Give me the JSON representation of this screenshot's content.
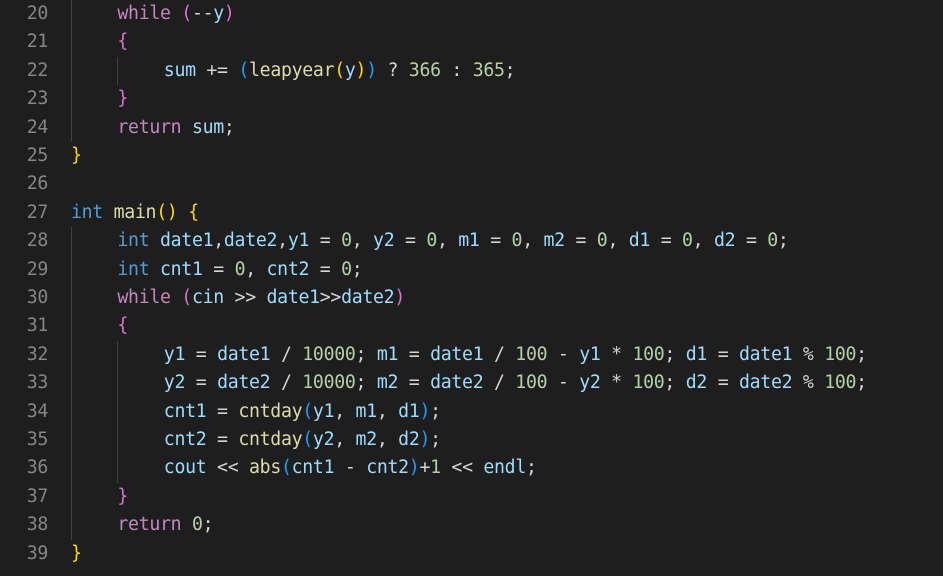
{
  "editor": {
    "language": "C++",
    "theme_colors": {
      "background": "#1e1e1e",
      "line_number": "#858585",
      "keyword": "#569cd6",
      "control": "#c586c0",
      "variable": "#9cdcfe",
      "function": "#dcdcaa",
      "number": "#b5cea8",
      "bracket_level_1": "#ffd700",
      "bracket_level_2": "#da70d6",
      "bracket_level_3": "#179fff"
    },
    "lines": [
      {
        "n": "20",
        "tokens": [
          [
            "ctl",
            "while"
          ],
          [
            "op",
            " "
          ],
          [
            "b2",
            "("
          ],
          [
            "op",
            "--"
          ],
          [
            "var",
            "y"
          ],
          [
            "b2",
            ")"
          ]
        ]
      },
      {
        "n": "21",
        "tokens": [
          [
            "b2",
            "{"
          ]
        ]
      },
      {
        "n": "22",
        "tokens": [
          [
            "var",
            "sum"
          ],
          [
            "op",
            " += "
          ],
          [
            "b3",
            "("
          ],
          [
            "fn",
            "leapyear"
          ],
          [
            "b1",
            "("
          ],
          [
            "var",
            "y"
          ],
          [
            "b1",
            ")"
          ],
          [
            "b3",
            ")"
          ],
          [
            "op",
            " ? "
          ],
          [
            "num",
            "366"
          ],
          [
            "op",
            " : "
          ],
          [
            "num",
            "365"
          ],
          [
            "op",
            ";"
          ]
        ]
      },
      {
        "n": "23",
        "tokens": [
          [
            "b2",
            "}"
          ]
        ]
      },
      {
        "n": "24",
        "tokens": [
          [
            "ctl",
            "return"
          ],
          [
            "op",
            " "
          ],
          [
            "var",
            "sum"
          ],
          [
            "op",
            ";"
          ]
        ]
      },
      {
        "n": "25",
        "tokens": [
          [
            "b1",
            "}"
          ]
        ]
      },
      {
        "n": "26",
        "tokens": []
      },
      {
        "n": "27",
        "tokens": [
          [
            "kw",
            "int"
          ],
          [
            "op",
            " "
          ],
          [
            "fn",
            "main"
          ],
          [
            "b1",
            "()"
          ],
          [
            "op",
            " "
          ],
          [
            "b1",
            "{"
          ]
        ]
      },
      {
        "n": "28",
        "tokens": [
          [
            "kw",
            "int"
          ],
          [
            "op",
            " "
          ],
          [
            "var",
            "date1"
          ],
          [
            "op",
            ","
          ],
          [
            "var",
            "date2"
          ],
          [
            "op",
            ","
          ],
          [
            "var",
            "y1"
          ],
          [
            "op",
            " = "
          ],
          [
            "num",
            "0"
          ],
          [
            "op",
            ", "
          ],
          [
            "var",
            "y2"
          ],
          [
            "op",
            " = "
          ],
          [
            "num",
            "0"
          ],
          [
            "op",
            ", "
          ],
          [
            "var",
            "m1"
          ],
          [
            "op",
            " = "
          ],
          [
            "num",
            "0"
          ],
          [
            "op",
            ", "
          ],
          [
            "var",
            "m2"
          ],
          [
            "op",
            " = "
          ],
          [
            "num",
            "0"
          ],
          [
            "op",
            ", "
          ],
          [
            "var",
            "d1"
          ],
          [
            "op",
            " = "
          ],
          [
            "num",
            "0"
          ],
          [
            "op",
            ", "
          ],
          [
            "var",
            "d2"
          ],
          [
            "op",
            " = "
          ],
          [
            "num",
            "0"
          ],
          [
            "op",
            ";"
          ]
        ]
      },
      {
        "n": "29",
        "tokens": [
          [
            "kw",
            "int"
          ],
          [
            "op",
            " "
          ],
          [
            "var",
            "cnt1"
          ],
          [
            "op",
            " = "
          ],
          [
            "num",
            "0"
          ],
          [
            "op",
            ", "
          ],
          [
            "var",
            "cnt2"
          ],
          [
            "op",
            " = "
          ],
          [
            "num",
            "0"
          ],
          [
            "op",
            ";"
          ]
        ]
      },
      {
        "n": "30",
        "tokens": [
          [
            "ctl",
            "while"
          ],
          [
            "op",
            " "
          ],
          [
            "b2",
            "("
          ],
          [
            "var",
            "cin"
          ],
          [
            "op",
            " >> "
          ],
          [
            "var",
            "date1"
          ],
          [
            "op",
            ">>"
          ],
          [
            "var",
            "date2"
          ],
          [
            "b2",
            ")"
          ]
        ]
      },
      {
        "n": "31",
        "tokens": [
          [
            "b2",
            "{"
          ]
        ]
      },
      {
        "n": "32",
        "tokens": [
          [
            "var",
            "y1"
          ],
          [
            "op",
            " = "
          ],
          [
            "var",
            "date1"
          ],
          [
            "op",
            " / "
          ],
          [
            "num",
            "10000"
          ],
          [
            "op",
            "; "
          ],
          [
            "var",
            "m1"
          ],
          [
            "op",
            " = "
          ],
          [
            "var",
            "date1"
          ],
          [
            "op",
            " / "
          ],
          [
            "num",
            "100"
          ],
          [
            "op",
            " - "
          ],
          [
            "var",
            "y1"
          ],
          [
            "op",
            " * "
          ],
          [
            "num",
            "100"
          ],
          [
            "op",
            "; "
          ],
          [
            "var",
            "d1"
          ],
          [
            "op",
            " = "
          ],
          [
            "var",
            "date1"
          ],
          [
            "op",
            " % "
          ],
          [
            "num",
            "100"
          ],
          [
            "op",
            ";"
          ]
        ]
      },
      {
        "n": "33",
        "tokens": [
          [
            "var",
            "y2"
          ],
          [
            "op",
            " = "
          ],
          [
            "var",
            "date2"
          ],
          [
            "op",
            " / "
          ],
          [
            "num",
            "10000"
          ],
          [
            "op",
            "; "
          ],
          [
            "var",
            "m2"
          ],
          [
            "op",
            " = "
          ],
          [
            "var",
            "date2"
          ],
          [
            "op",
            " / "
          ],
          [
            "num",
            "100"
          ],
          [
            "op",
            " - "
          ],
          [
            "var",
            "y2"
          ],
          [
            "op",
            " * "
          ],
          [
            "num",
            "100"
          ],
          [
            "op",
            "; "
          ],
          [
            "var",
            "d2"
          ],
          [
            "op",
            " = "
          ],
          [
            "var",
            "date2"
          ],
          [
            "op",
            " % "
          ],
          [
            "num",
            "100"
          ],
          [
            "op",
            ";"
          ]
        ]
      },
      {
        "n": "34",
        "tokens": [
          [
            "var",
            "cnt1"
          ],
          [
            "op",
            " = "
          ],
          [
            "fn",
            "cntday"
          ],
          [
            "b3",
            "("
          ],
          [
            "var",
            "y1"
          ],
          [
            "op",
            ", "
          ],
          [
            "var",
            "m1"
          ],
          [
            "op",
            ", "
          ],
          [
            "var",
            "d1"
          ],
          [
            "b3",
            ")"
          ],
          [
            "op",
            ";"
          ]
        ]
      },
      {
        "n": "35",
        "tokens": [
          [
            "var",
            "cnt2"
          ],
          [
            "op",
            " = "
          ],
          [
            "fn",
            "cntday"
          ],
          [
            "b3",
            "("
          ],
          [
            "var",
            "y2"
          ],
          [
            "op",
            ", "
          ],
          [
            "var",
            "m2"
          ],
          [
            "op",
            ", "
          ],
          [
            "var",
            "d2"
          ],
          [
            "b3",
            ")"
          ],
          [
            "op",
            ";"
          ]
        ]
      },
      {
        "n": "36",
        "tokens": [
          [
            "var",
            "cout"
          ],
          [
            "op",
            " << "
          ],
          [
            "fn",
            "abs"
          ],
          [
            "b3",
            "("
          ],
          [
            "var",
            "cnt1"
          ],
          [
            "op",
            " - "
          ],
          [
            "var",
            "cnt2"
          ],
          [
            "b3",
            ")"
          ],
          [
            "op",
            "+"
          ],
          [
            "num",
            "1"
          ],
          [
            "op",
            " << "
          ],
          [
            "var",
            "endl"
          ],
          [
            "op",
            ";"
          ]
        ]
      },
      {
        "n": "37",
        "tokens": [
          [
            "b2",
            "}"
          ]
        ]
      },
      {
        "n": "38",
        "tokens": [
          [
            "ctl",
            "return"
          ],
          [
            "op",
            " "
          ],
          [
            "num",
            "0"
          ],
          [
            "op",
            ";"
          ]
        ]
      },
      {
        "n": "39",
        "tokens": [
          [
            "b1",
            "}"
          ]
        ]
      }
    ]
  }
}
